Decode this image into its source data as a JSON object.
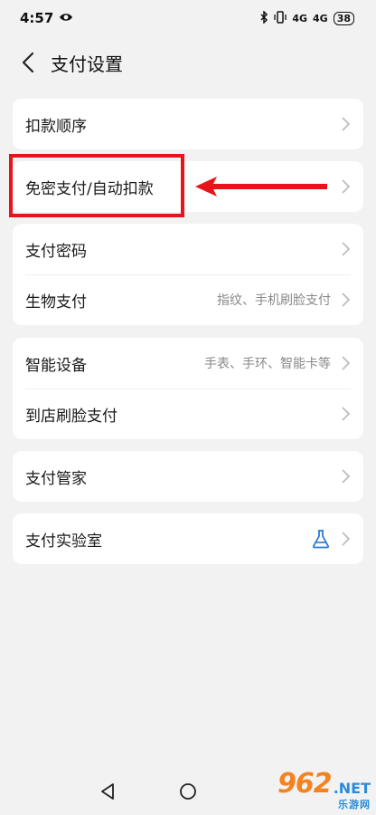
{
  "status_bar": {
    "time": "4:57",
    "signal_1": "4G",
    "signal_2": "4G",
    "battery": "38"
  },
  "header": {
    "title": "支付设置"
  },
  "groups": [
    {
      "items": [
        {
          "label": "扣款顺序",
          "hint": ""
        }
      ]
    },
    {
      "items": [
        {
          "label": "免密支付/自动扣款",
          "hint": ""
        }
      ]
    },
    {
      "items": [
        {
          "label": "支付密码",
          "hint": ""
        },
        {
          "label": "生物支付",
          "hint": "指纹、手机刷脸支付"
        }
      ]
    },
    {
      "items": [
        {
          "label": "智能设备",
          "hint": "手表、手环、智能卡等"
        },
        {
          "label": "到店刷脸支付",
          "hint": ""
        }
      ]
    },
    {
      "items": [
        {
          "label": "支付管家",
          "hint": ""
        }
      ]
    },
    {
      "items": [
        {
          "label": "支付实验室",
          "hint": "",
          "icon": "flask-icon"
        }
      ]
    }
  ],
  "annotation": {
    "highlight_color": "#e8141c"
  },
  "watermark": {
    "main": "962",
    "net": ".NET",
    "sub": "乐游网"
  },
  "colors": {
    "background": "#f2f2f2",
    "card": "#ffffff",
    "accent_blue": "#2a7ad5",
    "chevron": "#bdbdbd"
  }
}
